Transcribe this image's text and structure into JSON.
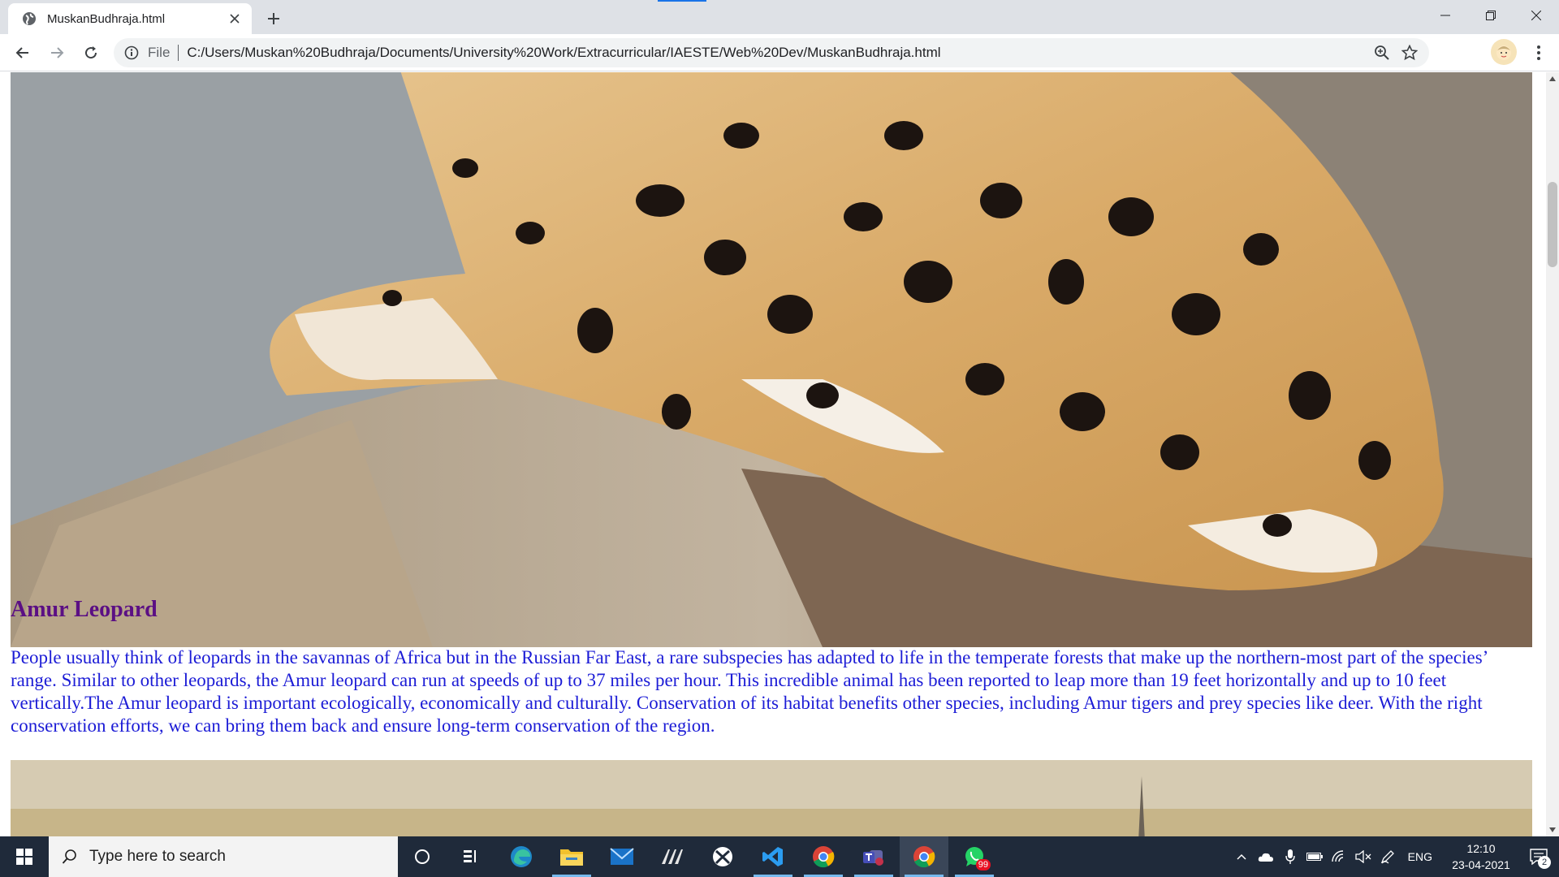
{
  "browser": {
    "tab_title": "MuskanBudhraja.html",
    "scheme": "File",
    "url": "C:/Users/Muskan%20Budhraja/Documents/University%20Work/Extracurricular/IAESTE/Web%20Dev/MuskanBudhraja.html"
  },
  "page": {
    "heading": "Amur Leopard",
    "paragraph": "People usually think of leopards in the savannas of Africa but in the Russian Far East, a rare subspecies has adapted to life in the temperate forests that make up the northern-most part of the species’ range. Similar to other leopards, the Amur leopard can run at speeds of up to 37 miles per hour. This incredible animal has been reported to leap more than 19 feet horizontally and up to 10 feet vertically.The Amur leopard is important ecologically, economically and culturally. Conservation of its habitat benefits other species, including Amur tigers and prey species like deer. With the right conservation efforts, we can bring them back and ensure long-term conservation of the region."
  },
  "taskbar": {
    "search_placeholder": "Type here to search",
    "whatsapp_badge": "99",
    "language": "ENG",
    "time": "12:10",
    "date": "23-04-2021",
    "notification_count": "2"
  },
  "colors": {
    "heading": "#5b0f84",
    "paragraph": "#1c1cd6",
    "taskbar": "#1f2a3a"
  }
}
